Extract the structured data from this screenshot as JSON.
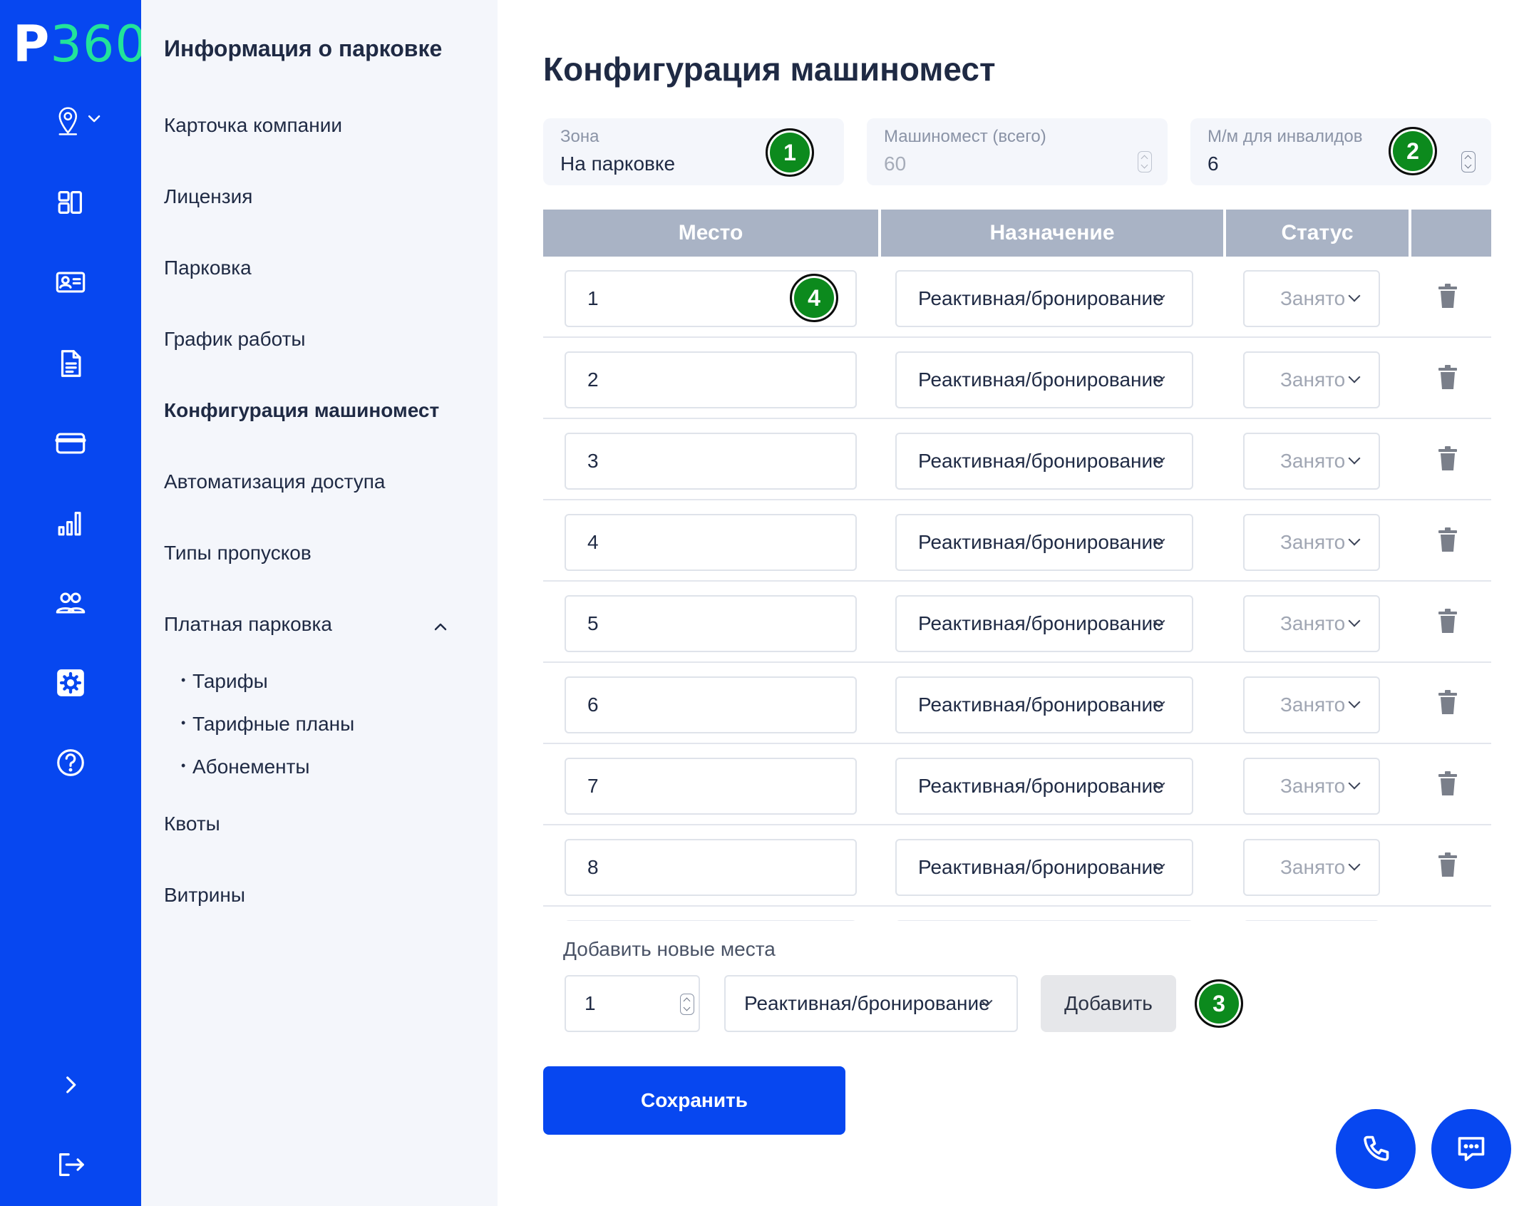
{
  "app": {
    "logo_p": "P",
    "logo_num": "360"
  },
  "sidebar": {
    "title": "Информация о парковке",
    "items": [
      {
        "label": "Карточка компании"
      },
      {
        "label": "Лицензия"
      },
      {
        "label": "Парковка"
      },
      {
        "label": "График работы"
      },
      {
        "label": "Конфигурация машиномест",
        "active": true
      },
      {
        "label": "Автоматизация доступа"
      },
      {
        "label": "Типы пропусков"
      },
      {
        "label": "Платная парковка",
        "expanded": true
      }
    ],
    "subitems": [
      {
        "label": "Тарифы"
      },
      {
        "label": "Тарифные планы"
      },
      {
        "label": "Абонементы"
      }
    ],
    "bottom_items": [
      {
        "label": "Квоты"
      },
      {
        "label": "Витрины"
      }
    ]
  },
  "rail_icons": [
    "location-icon",
    "dashboard-icon",
    "id-card-icon",
    "document-icon",
    "credit-card-icon",
    "bar-chart-icon",
    "users-icon",
    "settings-icon",
    "help-icon",
    "expand-icon",
    "logout-icon"
  ],
  "main": {
    "title": "Конфигурация машиномест",
    "zone": {
      "label": "Зона",
      "value": "На парковке"
    },
    "total": {
      "label": "Машиномест (всего)",
      "value": "60"
    },
    "disabled": {
      "label": "М/м для инвалидов",
      "value": "6"
    },
    "table": {
      "headers": [
        "Место",
        "Назначение",
        "Статус"
      ],
      "rows": [
        {
          "num": "1",
          "dest": "Реактивная/бронирование",
          "status": "Занято"
        },
        {
          "num": "2",
          "dest": "Реактивная/бронирование",
          "status": "Занято"
        },
        {
          "num": "3",
          "dest": "Реактивная/бронирование",
          "status": "Занято"
        },
        {
          "num": "4",
          "dest": "Реактивная/бронирование",
          "status": "Занято"
        },
        {
          "num": "5",
          "dest": "Реактивная/бронирование",
          "status": "Занято"
        },
        {
          "num": "6",
          "dest": "Реактивная/бронирование",
          "status": "Занято"
        },
        {
          "num": "7",
          "dest": "Реактивная/бронирование",
          "status": "Занято"
        },
        {
          "num": "8",
          "dest": "Реактивная/бронирование",
          "status": "Занято"
        }
      ]
    },
    "add": {
      "label": "Добавить новые места",
      "count": "1",
      "dest": "Реактивная/бронирование",
      "button": "Добавить"
    },
    "save_button": "Сохранить"
  },
  "badges": [
    "1",
    "2",
    "3",
    "4"
  ],
  "colors": {
    "brand": "#0747f0",
    "accent": "#22e39a",
    "badge": "#0c8a1d",
    "header": "#a9b3c5"
  }
}
